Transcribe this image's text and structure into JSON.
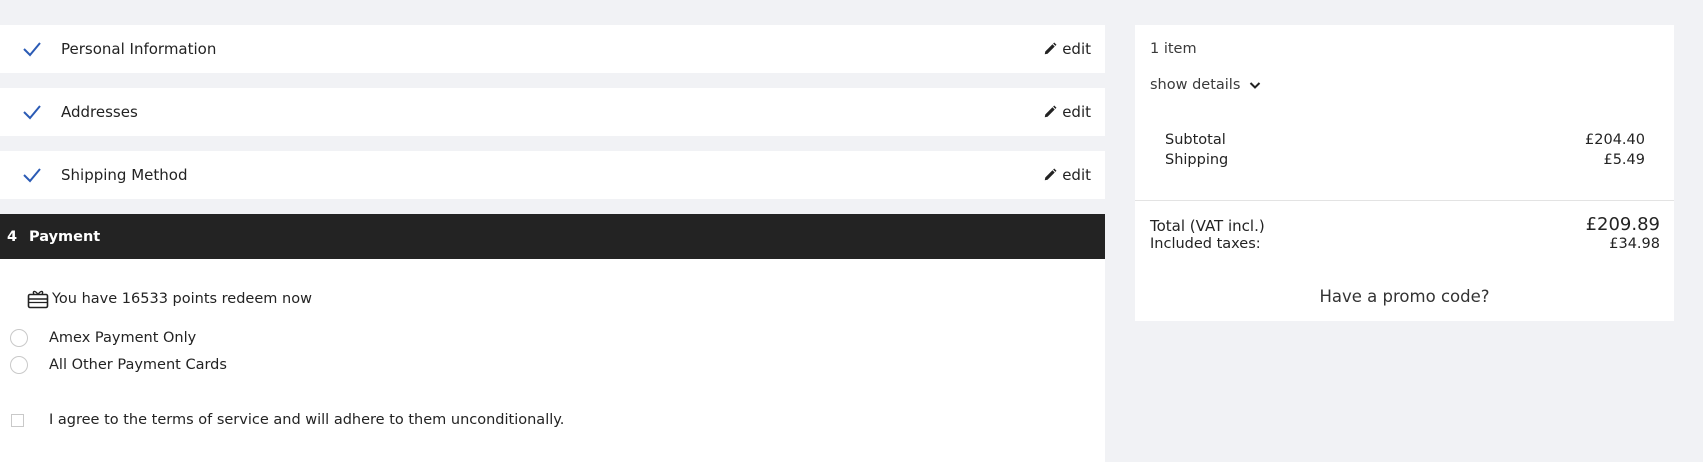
{
  "steps": [
    {
      "title": "Personal Information",
      "edit": "edit"
    },
    {
      "title": "Addresses",
      "edit": "edit"
    },
    {
      "title": "Shipping Method",
      "edit": "edit"
    }
  ],
  "payment": {
    "number": "4",
    "title": "Payment",
    "points_text": "You have 16533 points redeem now",
    "options": [
      "Amex Payment Only",
      "All Other Payment Cards"
    ],
    "terms": "I agree to the terms of service and will adhere to them unconditionally."
  },
  "summary": {
    "item_count": "1 item",
    "show_details": "show details",
    "subtotal_label": "Subtotal",
    "subtotal_value": "£204.40",
    "shipping_label": "Shipping",
    "shipping_value": "£5.49",
    "total_label": "Total (VAT incl.)",
    "total_value": "£209.89",
    "taxes_label": "Included taxes:",
    "taxes_value": "£34.98",
    "promo": "Have a promo code?"
  },
  "colors": {
    "check": "#2b5bb5",
    "dark_header": "#232323",
    "page_bg": "#f1f2f5"
  },
  "icons": {
    "check": "check-icon",
    "edit": "pencil-icon",
    "points": "gift-card-icon",
    "details": "chevron-down-icon"
  }
}
